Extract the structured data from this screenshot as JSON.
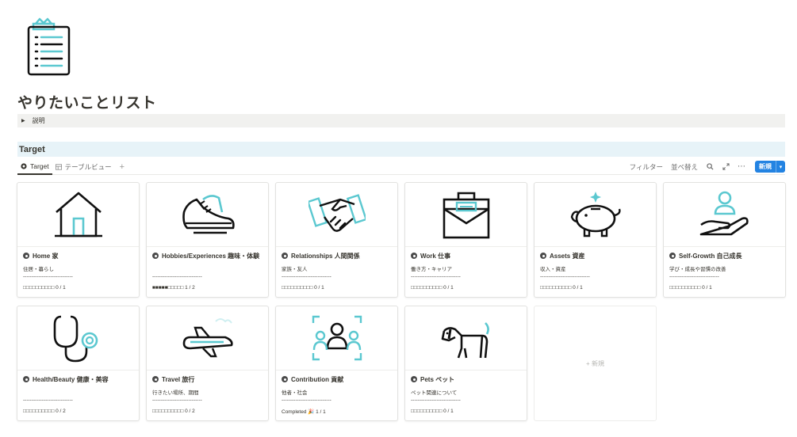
{
  "page": {
    "title": "やりたいことリスト",
    "icon": "clipboard-list-crown-icon",
    "toggle_label": "説明"
  },
  "section": {
    "heading": "Target"
  },
  "views": {
    "tabs": [
      {
        "label": "Target",
        "icon": "gallery-icon",
        "active": true
      },
      {
        "label": "テーブルビュー",
        "icon": "table-icon",
        "active": false
      }
    ],
    "add_label": "+"
  },
  "toolbar": {
    "filter": "フィルター",
    "sort": "並べ替え",
    "new_label": "新規"
  },
  "cards": [
    {
      "name": "Home 家",
      "desc": "住居・暮らし",
      "sep": "-----------------------------",
      "progress": "□□□□□□□□□□ 0 / 1",
      "cover": "house-icon"
    },
    {
      "name": "Hobbies/Experiences 趣味・体験",
      "desc": "",
      "sep": "-----------------------------",
      "progress": "■■■■■□□□□□ 1 / 2",
      "cover": "sneaker-icon"
    },
    {
      "name": "Relationships 人間関係",
      "desc": "家族・友人",
      "sep": "-----------------------------",
      "progress": "□□□□□□□□□□ 0 / 1",
      "cover": "handshake-icon"
    },
    {
      "name": "Work 仕事",
      "desc": "働き方・キャリア",
      "sep": "-----------------------------",
      "progress": "□□□□□□□□□□ 0 / 1",
      "cover": "briefcase-icon"
    },
    {
      "name": "Assets 資産",
      "desc": "収入・資産",
      "sep": "-----------------------------",
      "progress": "□□□□□□□□□□ 0 / 1",
      "cover": "piggy-bank-icon"
    },
    {
      "name": "Self-Growth 自己成長",
      "desc": "学び・成長や習慣の改善",
      "sep": "-----------------------------",
      "progress": "□□□□□□□□□□ 0 / 1",
      "cover": "hand-person-icon"
    },
    {
      "name": "Health/Beauty 健康・美容",
      "desc": "",
      "sep": "-----------------------------",
      "progress": "□□□□□□□□□□ 0 / 2",
      "cover": "stethoscope-icon"
    },
    {
      "name": "Travel 旅行",
      "desc": "行きたい場所、期間",
      "sep": "-----------------------------",
      "progress": "□□□□□□□□□□ 0 / 2",
      "cover": "airplane-icon"
    },
    {
      "name": "Contribution 貢献",
      "desc": "他者・社会",
      "sep": "-----------------------------",
      "progress": "Completed 🎉 1 / 1",
      "cover": "group-people-icon"
    },
    {
      "name": "Pets ペット",
      "desc": "ペット関連について",
      "sep": "-----------------------------",
      "progress": "□□□□□□□□□□ 0 / 1",
      "cover": "dog-icon"
    }
  ],
  "add_card_label": "+ 新規",
  "colors": {
    "accent": "#5bc8d0",
    "ink": "#111111",
    "button": "#2383e2",
    "header_bg": "#e7f3f8"
  }
}
